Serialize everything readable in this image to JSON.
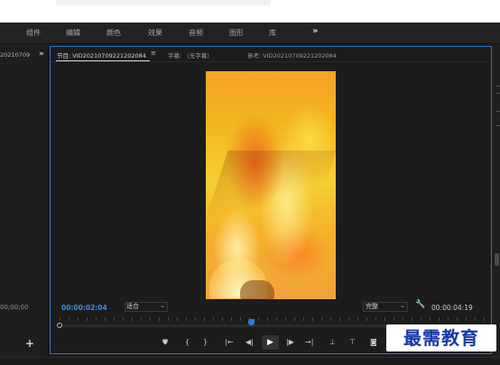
{
  "workspaces": {
    "items": [
      "组件",
      "编辑",
      "颜色",
      "效果",
      "音频",
      "图形",
      "库"
    ],
    "more_glyph": "»"
  },
  "project_panel": {
    "tab_label": "20210709",
    "more_glyph": "»",
    "timecode": "00;00;00",
    "add_glyph": "+"
  },
  "monitor": {
    "tabs": {
      "program": "节目: VID20210709221202084",
      "menu_glyph": "≡",
      "captions": "字幕: （无字幕）",
      "reference": "参考: VID20210709221202084"
    },
    "current_timecode": "00:00:02:04",
    "fit_select": {
      "value": "适合"
    },
    "resolution_select": {
      "value": "完整"
    },
    "duration_timecode": "00:00:04:19",
    "playback_progress": 0.45,
    "transport": {
      "add_marker": "⛊",
      "mark_in": "{",
      "mark_out": "}",
      "go_to_in": "|←",
      "step_back": "◀|",
      "play": "▶",
      "step_forward": "|▶",
      "go_to_out": "→|",
      "lift": "⊥",
      "extract": "⊤",
      "export_frame": "◙"
    }
  },
  "watermark": {
    "text": "最需教育"
  },
  "colors": {
    "accent": "#2d74c9",
    "timecode_blue": "#3d8ee6",
    "panel_bg": "#1c1c1c"
  },
  "icons": [
    "chevron-double-right-icon",
    "hamburger-menu-icon",
    "wrench-icon",
    "chevron-down-icon",
    "marker-icon",
    "play-icon",
    "camera-icon",
    "plus-icon"
  ]
}
